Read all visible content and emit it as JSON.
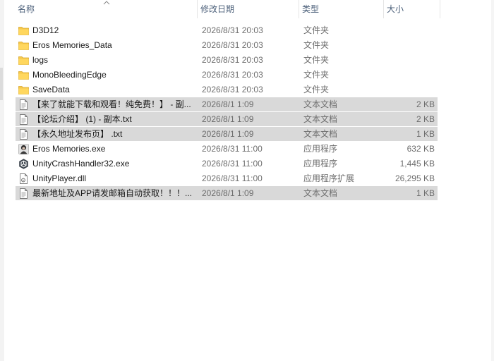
{
  "columns": {
    "name": "名称",
    "modified": "修改日期",
    "type": "类型",
    "size": "大小"
  },
  "files": [
    {
      "name": "D3D12",
      "modified": "2026/8/31 20:03",
      "type": "文件夹",
      "size": "",
      "icon": "folder-icon",
      "selected": false
    },
    {
      "name": "Eros Memories_Data",
      "modified": "2026/8/31 20:03",
      "type": "文件夹",
      "size": "",
      "icon": "folder-icon",
      "selected": false
    },
    {
      "name": "logs",
      "modified": "2026/8/31 20:03",
      "type": "文件夹",
      "size": "",
      "icon": "folder-icon",
      "selected": false
    },
    {
      "name": "MonoBleedingEdge",
      "modified": "2026/8/31 20:03",
      "type": "文件夹",
      "size": "",
      "icon": "folder-icon",
      "selected": false
    },
    {
      "name": "SaveData",
      "modified": "2026/8/31 20:03",
      "type": "文件夹",
      "size": "",
      "icon": "folder-icon",
      "selected": false
    },
    {
      "name": "【来了就能下载和观看！纯免费！】 - 副...",
      "modified": "2026/8/1 1:09",
      "type": "文本文档",
      "size": "2 KB",
      "icon": "text-file-icon",
      "selected": true
    },
    {
      "name": "【论坛介绍】 (1) - 副本.txt",
      "modified": "2026/8/1 1:09",
      "type": "文本文档",
      "size": "2 KB",
      "icon": "text-file-icon",
      "selected": true
    },
    {
      "name": "【永久地址发布页】 .txt",
      "modified": "2026/8/1 1:09",
      "type": "文本文档",
      "size": "1 KB",
      "icon": "text-file-icon",
      "selected": true
    },
    {
      "name": "Eros Memories.exe",
      "modified": "2026/8/31 11:00",
      "type": "应用程序",
      "size": "632 KB",
      "icon": "game-app-icon",
      "selected": false
    },
    {
      "name": "UnityCrashHandler32.exe",
      "modified": "2026/8/31 11:00",
      "type": "应用程序",
      "size": "1,445 KB",
      "icon": "unity-app-icon",
      "selected": false
    },
    {
      "name": "UnityPlayer.dll",
      "modified": "2026/8/31 11:00",
      "type": "应用程序扩展",
      "size": "26,295 KB",
      "icon": "dll-file-icon",
      "selected": false
    },
    {
      "name": "最新地址及APP请发邮箱自动获取！！！...",
      "modified": "2026/8/1 1:09",
      "type": "文本文档",
      "size": "1 KB",
      "icon": "text-file-icon",
      "selected": true
    }
  ]
}
